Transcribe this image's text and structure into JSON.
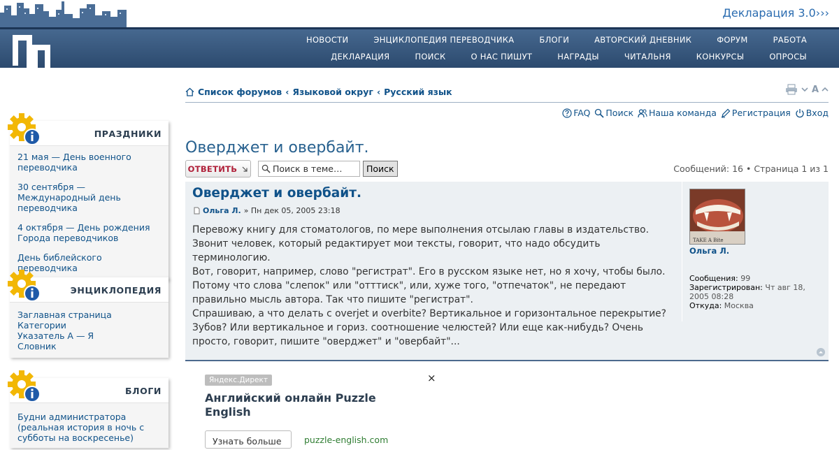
{
  "header": {
    "declaration_link": "Декларация 3.0›››",
    "nav_row1": [
      "НОВОСТИ",
      "ЭНЦИКЛОПЕДИЯ ПЕРЕВОДЧИКА",
      "БЛОГИ",
      "АВТОРСКИЙ ДНЕВНИК",
      "ФОРУМ",
      "РАБОТА"
    ],
    "nav_row2": [
      "ДЕКЛАРАЦИЯ",
      "ПОИСК",
      "О НАС ПИШУТ",
      "НАГРАДЫ",
      "ЧИТАЛЬНЯ",
      "КОНКУРСЫ",
      "ОПРОСЫ"
    ]
  },
  "sidebar": {
    "holidays": {
      "title": "ПРАЗДНИКИ",
      "items": [
        "21 мая — День военного переводчика",
        "30 сентября — Международный день переводчика",
        "4 октября — День рождения Города переводчиков",
        "День библейского переводчика"
      ]
    },
    "encyclopedia": {
      "title": "ЭНЦИКЛОПЕДИЯ",
      "items": [
        "Заглавная страница",
        "Категории",
        "Указатель А — Я",
        "Словник"
      ]
    },
    "blogs": {
      "title": "БЛОГИ",
      "items": [
        "Будни администратора (реальная история в ночь с субботы на воскресенье)"
      ]
    }
  },
  "breadcrumbs": {
    "items": [
      "Список форумов",
      "Языковой округ",
      "Русский язык"
    ],
    "separator": "‹"
  },
  "tools": {
    "font_size_label": "A"
  },
  "quicklinks": [
    "FAQ",
    "Поиск",
    "Наша команда",
    "Регистрация",
    "Вход"
  ],
  "topic": {
    "title": "Оверджет и овербайт.",
    "reply_label": "ОТВЕТИТЬ",
    "search_placeholder": "Поиск в теме…",
    "search_button": "Поиск",
    "page_info": "Сообщений: 16 • Страница 1 из 1"
  },
  "post": {
    "title": "Оверджет и овербайт.",
    "author": "Ольга Л.",
    "date": "» Пн дек 05, 2005 23:18",
    "paragraphs": [
      "Перевожу книгу для стоматологов, по мере выполнения отсылаю главы в издательство. Звонит человек, который редактирует мои тексты, говорит, что надо обсудить терминологию.",
      "Вот, говорит, например, слово \"регистрат\". Его в русском языке нет, но я хочу, чтобы было. Потому что слова \"слепок\" или \"отттиск\", или, хуже того, \"отпечаток\", не передают правильно мысль автора. Так что пишите \"регистрат\".",
      "Спрашиваю, а что делать с overjet и overbite? Вертикальное и горизонтальное перекрытие? Зубов? Или вертикальное и гориз. соотношение челюстей? Или еще как-нибудь? Очень просто, говорит, пишите \"оверджет\" и \"овербайт\"..."
    ],
    "profile": {
      "name": "Ольга Л.",
      "avatar_text": "TAKE A Bite",
      "posts_label": "Сообщения:",
      "posts_value": "99",
      "registered_label": "Зарегистрирован:",
      "registered_value": "Чт авг 18, 2005 08:28",
      "from_label": "Откуда:",
      "from_value": "Москва"
    }
  },
  "ad": {
    "tag": "Яндекс.Директ",
    "close": "×",
    "title": "Английский онлайн Puzzle English",
    "button": "Узнать больше",
    "url": "puzzle-english.com"
  }
}
